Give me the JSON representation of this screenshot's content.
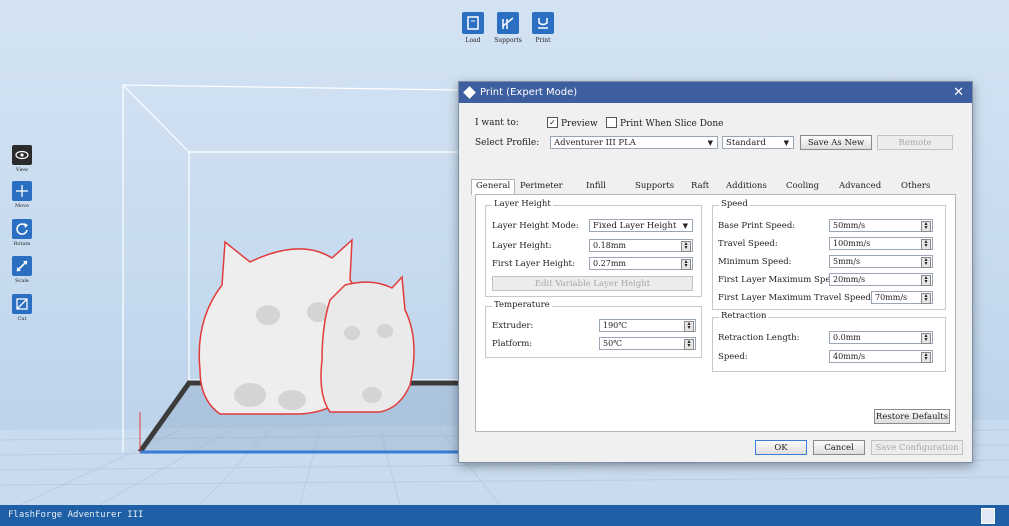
{
  "toolbar": {
    "load_label": "Load",
    "supports_label": "Supports",
    "print_label": "Print"
  },
  "left_tools": {
    "view_label": "View",
    "move_label": "Move",
    "rotate_label": "Rotate",
    "scale_label": "Scale",
    "cut_label": "Cut"
  },
  "dialog": {
    "title": "Print (Expert Mode)",
    "i_want_to_label": "I want to:",
    "preview_label": "Preview",
    "preview_checked": true,
    "print_when_slice_done_label": "Print When Slice Done",
    "print_when_slice_done_checked": false,
    "select_profile_label": "Select Profile:",
    "profile_value": "Adventurer III PLA",
    "quality_value": "Standard",
    "save_as_new_label": "Save As New",
    "remote_label": "Remote",
    "tabs": [
      "General",
      "Perimeter",
      "Infill",
      "Supports",
      "Raft",
      "Additions",
      "Cooling",
      "Advanced",
      "Others"
    ],
    "active_tab": "General",
    "layer_height_group": {
      "title": "Layer Height",
      "mode_label": "Layer Height Mode:",
      "mode_value": "Fixed Layer Height",
      "layer_height_label": "Layer Height:",
      "layer_height_value": "0.18mm",
      "first_layer_height_label": "First Layer Height:",
      "first_layer_height_value": "0.27mm",
      "edit_variable_label": "Edit Variable Layer Height"
    },
    "temperature_group": {
      "title": "Temperature",
      "extruder_label": "Extruder:",
      "extruder_value": "190℃",
      "platform_label": "Platform:",
      "platform_value": "50℃"
    },
    "speed_group": {
      "title": "Speed",
      "base_print_label": "Base Print Speed:",
      "base_print_value": "50mm/s",
      "travel_label": "Travel Speed:",
      "travel_value": "100mm/s",
      "minimum_label": "Minimum Speed:",
      "minimum_value": "5mm/s",
      "first_layer_max_label": "First Layer Maximum Speed:",
      "first_layer_max_value": "20mm/s",
      "first_layer_travel_label": "First Layer Maximum Travel Speed:",
      "first_layer_travel_value": "70mm/s"
    },
    "retraction_group": {
      "title": "Retraction",
      "length_label": "Retraction Length:",
      "length_value": "0.0mm",
      "speed_label": "Speed:",
      "speed_value": "40mm/s"
    },
    "restore_defaults_label": "Restore Defaults",
    "ok_label": "OK",
    "cancel_label": "Cancel",
    "save_configuration_label": "Save Configuration"
  },
  "status_bar": {
    "printer_name": "FlashForge Adventurer III"
  },
  "colors": {
    "accent": "#2a6fc2",
    "dialog_title": "#3d5fa0",
    "status_bar": "#1f5fa6",
    "model_outline": "#e23b3b"
  }
}
